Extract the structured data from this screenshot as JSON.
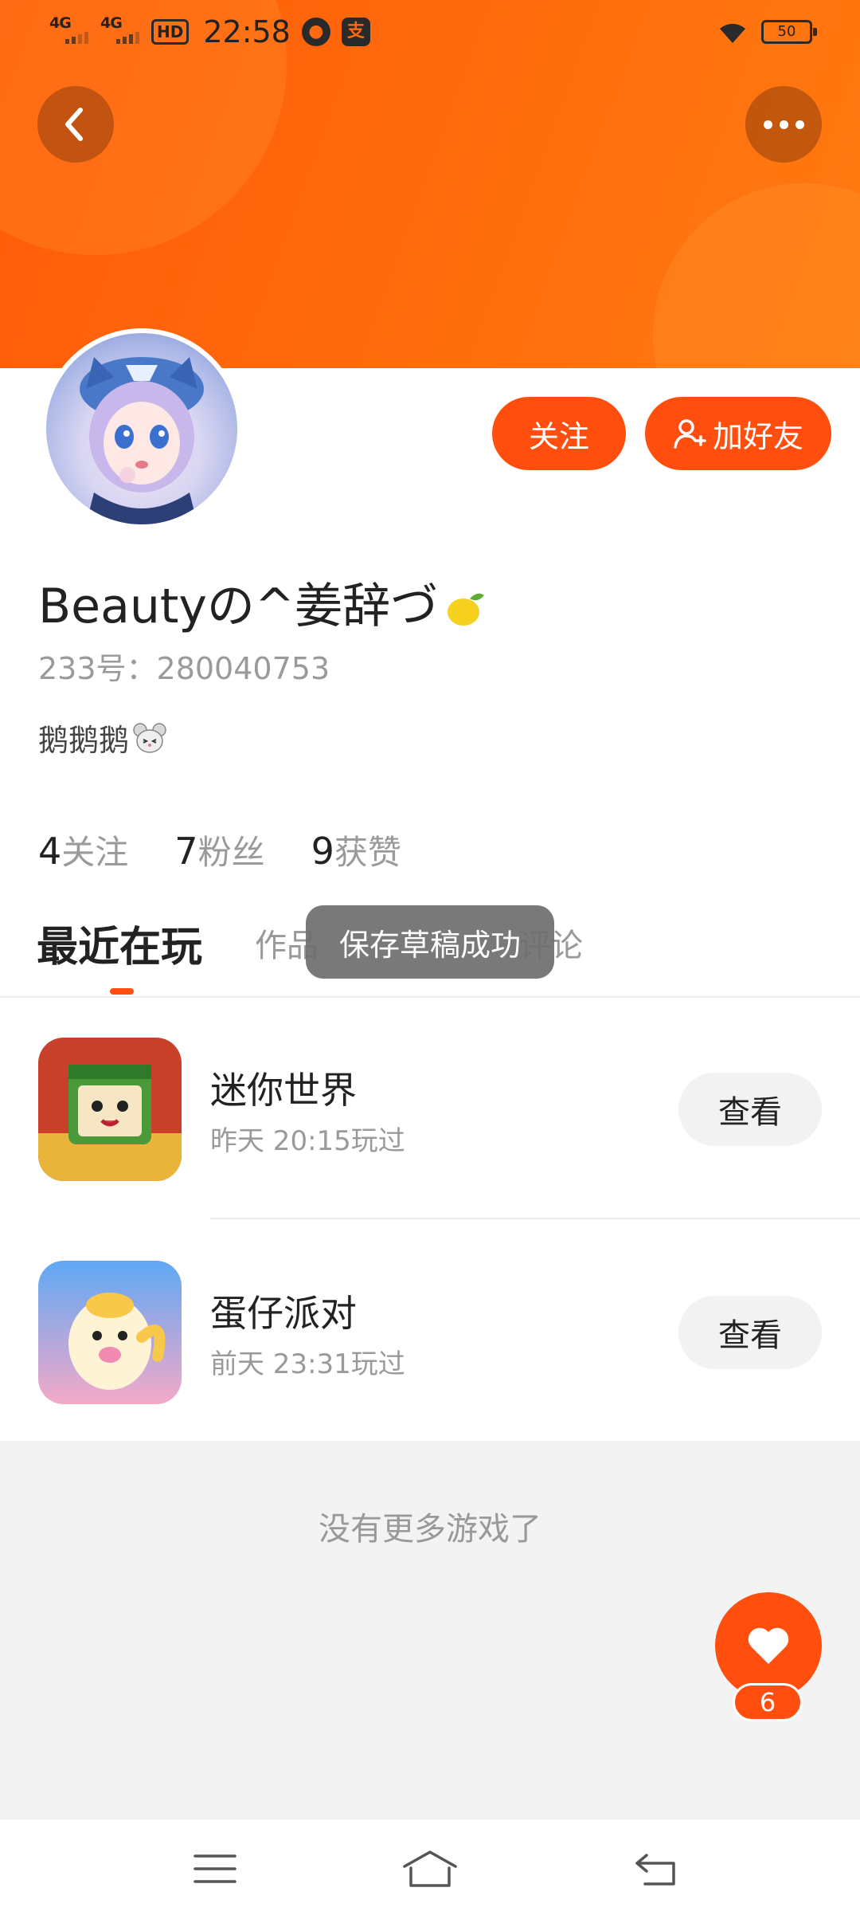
{
  "status_bar": {
    "network1": "4G",
    "network2": "4G",
    "hd_label": "HD",
    "time": "22:58",
    "battery": "50"
  },
  "header": {
    "back_icon": "chevron-left-icon",
    "more_icon": "more-dots-icon",
    "banner_color": "#ff6a0c"
  },
  "profile": {
    "nickname": "Beautyの^姜辞づ",
    "uid_label": "233号：",
    "uid": "280040753",
    "bio": "鹅鹅鹅",
    "follow_label": "关注",
    "add_friend_label": "加好友",
    "accent_color": "#ff4e0d"
  },
  "stats": [
    {
      "num": "4",
      "label": "关注"
    },
    {
      "num": "7",
      "label": "粉丝"
    },
    {
      "num": "9",
      "label": "获赞"
    }
  ],
  "tabs": [
    {
      "label": "最近在玩",
      "active": true
    },
    {
      "label": "作品",
      "active": false
    },
    {
      "label": "评论",
      "active": false
    }
  ],
  "toast": "保存草稿成功",
  "games": [
    {
      "name": "迷你世界",
      "time": "昨天 20:15玩过",
      "action": "查看"
    },
    {
      "name": "蛋仔派对",
      "time": "前天 23:31玩过",
      "action": "查看"
    }
  ],
  "no_more": "没有更多游戏了",
  "like": {
    "count": "6",
    "icon": "heart-icon"
  },
  "navbar": {
    "menu_icon": "menu-icon",
    "home_icon": "home-icon",
    "back_icon": "back-arrow-icon"
  }
}
